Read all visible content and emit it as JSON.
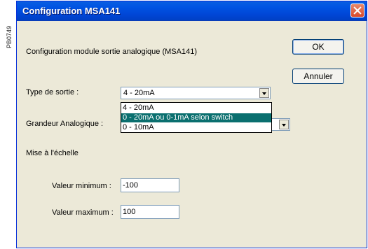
{
  "side_label": "PB0749",
  "window": {
    "title": "Configuration MSA141"
  },
  "description": "Configuration module sortie analogique (MSA141)",
  "buttons": {
    "ok": "OK",
    "cancel": "Annuler"
  },
  "type_sortie": {
    "label": "Type de sortie :",
    "value": "4 - 20mA",
    "options": [
      "4 - 20mA",
      "0 - 20mA  ou 0-1mA selon switch",
      "0 - 10mA"
    ],
    "highlighted_index": 1
  },
  "grandeur": {
    "label": "Grandeur Analogique :",
    "value": ""
  },
  "scale": {
    "title": "Mise à l'échelle",
    "min_label": "Valeur minimum :",
    "min_value": "-100",
    "max_label": "Valeur maximum :",
    "max_value": "100"
  },
  "colors": {
    "title_bar": "#0054e3",
    "highlight": "#0a6f6f",
    "dialog_bg": "#ece9d8"
  }
}
